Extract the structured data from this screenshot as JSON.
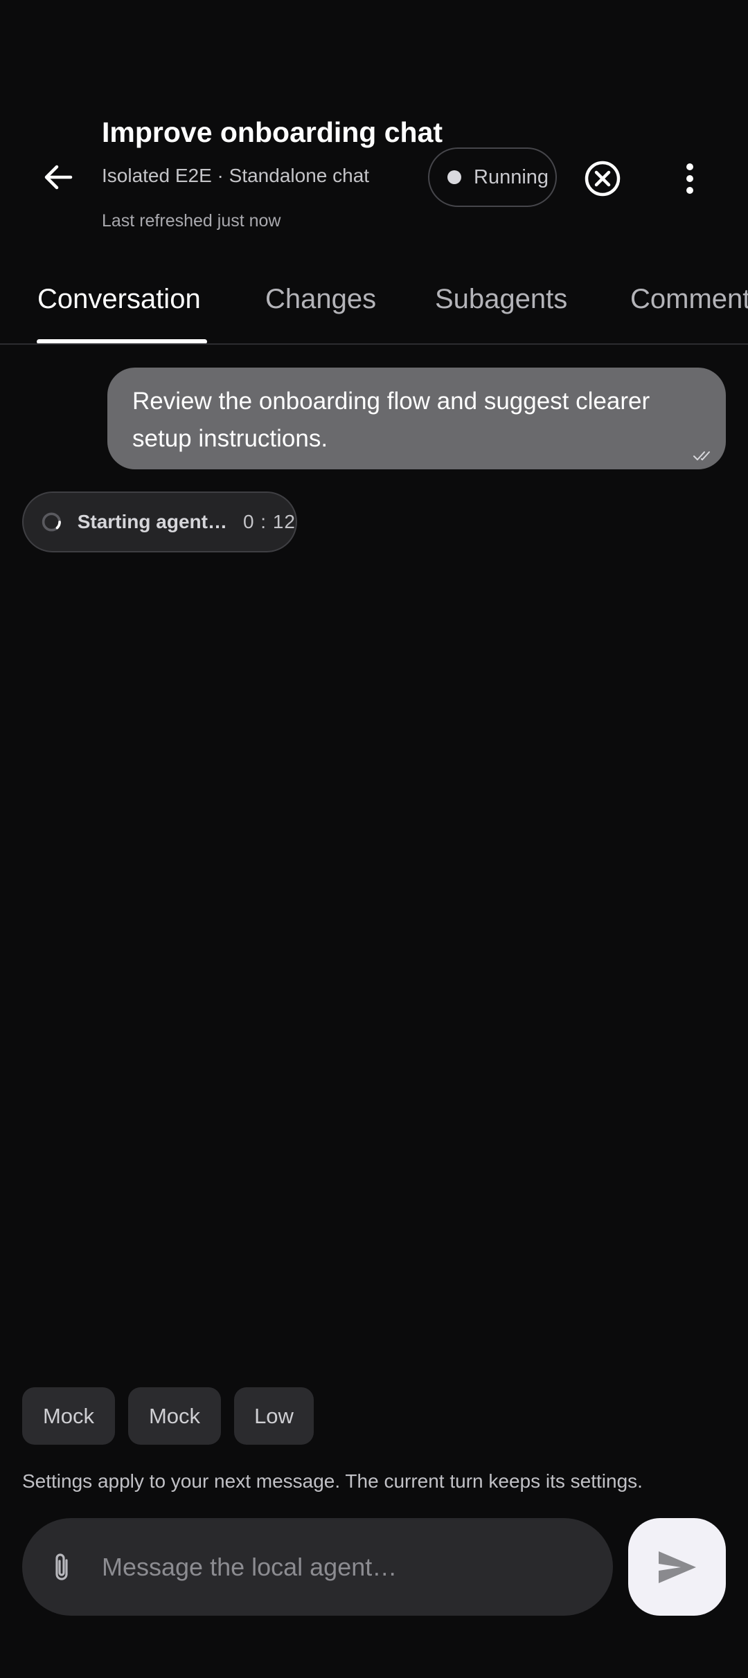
{
  "header": {
    "title": "Improve onboarding chat",
    "subtitle": "Isolated E2E · Standalone chat",
    "refreshed": "Last refreshed just now",
    "status": "Running",
    "icons": {
      "back": "arrow-left-icon",
      "cancel": "circle-x-icon",
      "more": "more-vertical-icon"
    }
  },
  "tabs": [
    {
      "label": "Conversation",
      "active": true
    },
    {
      "label": "Changes",
      "active": false
    },
    {
      "label": "Subagents",
      "active": false
    },
    {
      "label": "Comments",
      "active": false
    }
  ],
  "conversation": {
    "user_message": "Review the onboarding flow and suggest clearer setup instructions.",
    "agent_status": "Starting agent…",
    "agent_timer": "0 : 12"
  },
  "settings": {
    "chips": [
      "Mock",
      "Mock",
      "Low"
    ],
    "note": "Settings apply to your next message. The current turn keeps its settings."
  },
  "composer": {
    "placeholder": "Message the local agent…",
    "value": ""
  },
  "colors": {
    "background": "#0b0b0c",
    "user_bubble": "#6a6a6d",
    "send_button": "#f2f1f7",
    "composer": "#29292c"
  }
}
